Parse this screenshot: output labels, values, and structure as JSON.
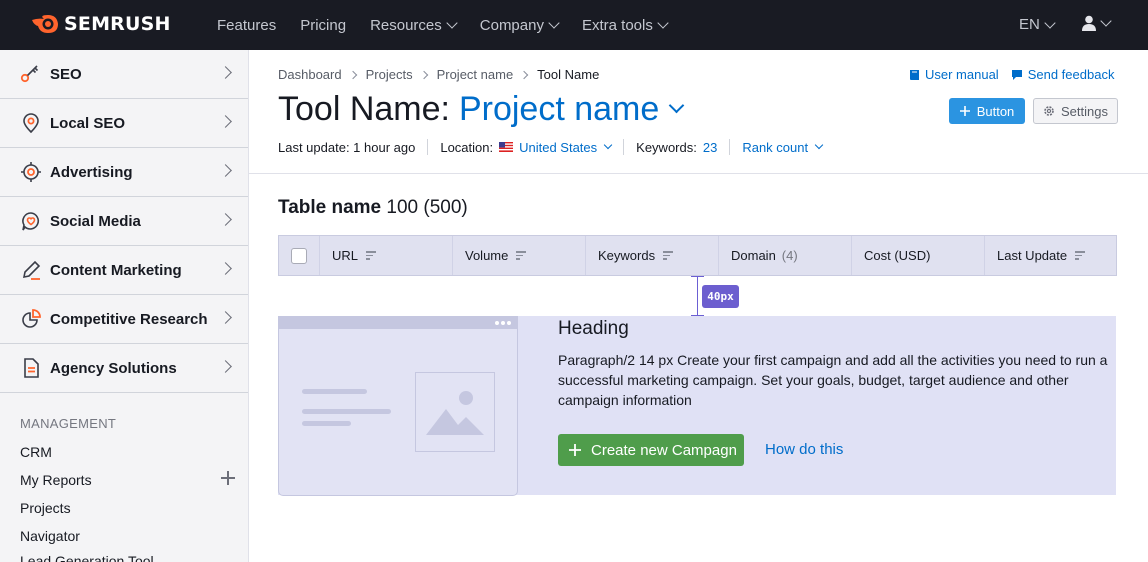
{
  "topbar": {
    "logo_text": "SEMRUSH",
    "nav": [
      {
        "label": "Features",
        "dropdown": false
      },
      {
        "label": "Pricing",
        "dropdown": false
      },
      {
        "label": "Resources",
        "dropdown": true
      },
      {
        "label": "Company",
        "dropdown": true
      },
      {
        "label": "Extra tools",
        "dropdown": true
      }
    ],
    "language": "EN",
    "user_icon": "user-icon"
  },
  "sidebar": {
    "items": [
      {
        "label": "SEO",
        "icon": "seo-key-icon"
      },
      {
        "label": "Local SEO",
        "icon": "map-pin-icon"
      },
      {
        "label": "Advertising",
        "icon": "target-icon"
      },
      {
        "label": "Social Media",
        "icon": "chat-bubble-icon"
      },
      {
        "label": "Content Marketing",
        "icon": "pencil-icon"
      },
      {
        "label": "Competitive Research",
        "icon": "pie-chart-icon"
      },
      {
        "label": "Agency Solutions",
        "icon": "document-icon"
      }
    ],
    "management_title": "MANAGEMENT",
    "management_items": [
      "CRM",
      "My Reports",
      "Projects",
      "Navigator",
      "Lead Generation Tool"
    ]
  },
  "breadcrumbs": {
    "items": [
      "Dashboard",
      "Projects",
      "Project name"
    ],
    "current": "Tool Name"
  },
  "top_links": {
    "manual": "User manual",
    "feedback": "Send feedback"
  },
  "header": {
    "title": "Tool Name:",
    "project": "Project name",
    "button_label": "Button",
    "settings_label": "Settings"
  },
  "meta": {
    "last_update": "Last update: 1 hour ago",
    "location_label": "Location:",
    "location_value": "United States",
    "keywords_label": "Keywords:",
    "keywords_value": "23",
    "rank_count": "Rank count"
  },
  "table": {
    "title": "Table name",
    "count": "100 (500)",
    "columns": [
      {
        "label": "URL",
        "sortable": true
      },
      {
        "label": "Volume",
        "sortable": true
      },
      {
        "label": "Keywords",
        "sortable": true
      },
      {
        "label": "Domain",
        "count": "(4)",
        "sortable": false
      },
      {
        "label": "Cost (USD)",
        "sortable": false
      },
      {
        "label": "Last Update",
        "sortable": true
      }
    ]
  },
  "spacing_tag": "40px",
  "empty_state": {
    "heading": "Heading",
    "paragraph": "Paragraph/2 14 px Create your first campaign and add all the activities you need to run a successful marketing campaign. Set your goals, budget, target audience and other campaign information",
    "create_button": "Create new Campagn",
    "link": "How do this"
  },
  "colors": {
    "topbar_bg": "#191b23",
    "accent_blue": "#006dca",
    "primary_button": "#2b94e1",
    "create_button": "#4f9d4b",
    "logo_orange": "#ff642d",
    "empty_bg": "#e0e1f5",
    "spacing_tag": "#6c5ecf"
  }
}
